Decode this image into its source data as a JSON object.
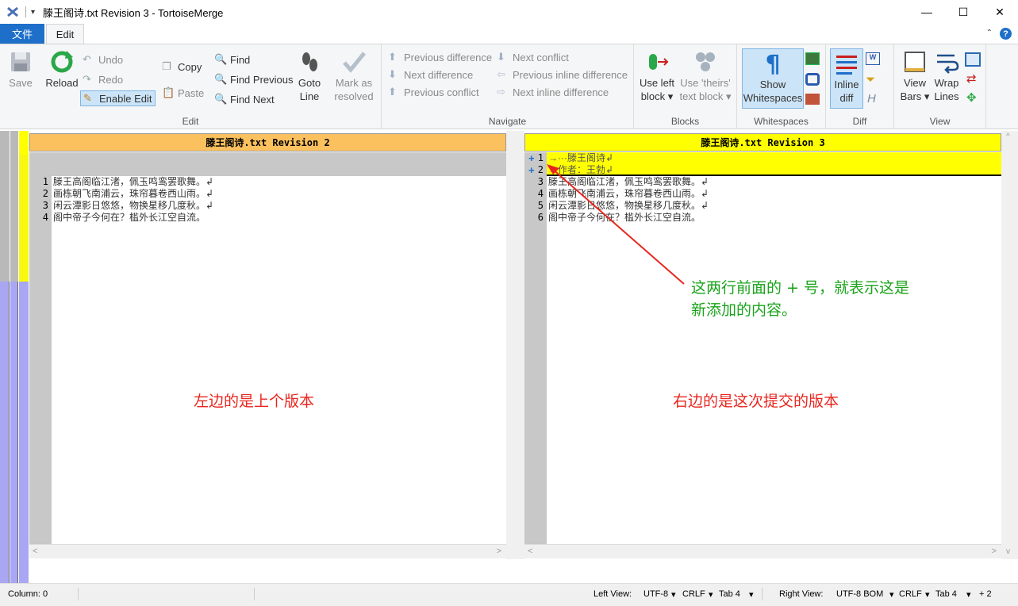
{
  "window": {
    "title": "滕王阁诗.txt Revision 3 - TortoiseMerge",
    "minimize": "—",
    "maximize": "☐",
    "close": "✕"
  },
  "tabs": {
    "file": "文件",
    "edit": "Edit",
    "help": "?"
  },
  "ribbon": {
    "save": "Save",
    "reload": "Reload",
    "undo": "Undo",
    "redo": "Redo",
    "enable_edit": "Enable Edit",
    "copy": "Copy",
    "paste": "Paste",
    "find": "Find",
    "find_previous": "Find Previous",
    "find_next": "Find Next",
    "goto_line_1": "Goto",
    "goto_line_2": "Line",
    "mark_resolved_1": "Mark as",
    "mark_resolved_2": "resolved",
    "edit_group": "Edit",
    "prev_diff": "Previous difference",
    "next_diff": "Next difference",
    "prev_conflict": "Previous conflict",
    "next_conflict": "Next conflict",
    "prev_inline": "Previous inline difference",
    "next_inline": "Next inline difference",
    "navigate_group": "Navigate",
    "use_left_1": "Use left",
    "use_left_2": "block ▾",
    "use_theirs_1": "Use 'theirs'",
    "use_theirs_2": "text block ▾",
    "blocks_group": "Blocks",
    "show_ws_1": "Show",
    "show_ws_2": "Whitespaces",
    "ws_group": "Whitespaces",
    "inline_1": "Inline",
    "inline_2": "diff",
    "diff_group": "Diff",
    "view_bars_1": "View",
    "view_bars_2": "Bars ▾",
    "wrap_1": "Wrap",
    "wrap_2": "Lines",
    "view_group": "View"
  },
  "left_pane": {
    "header": "滕王阁诗.txt Revision 2",
    "lines": [
      {
        "num": "1",
        "text": "滕王高阁临江渚，佩玉鸣鸾罢歌舞。↲"
      },
      {
        "num": "2",
        "text": "画栋朝飞南浦云，珠帘暮卷西山雨。↲"
      },
      {
        "num": "3",
        "text": "闲云潭影日悠悠，物换星移几度秋。↲"
      },
      {
        "num": "4",
        "text": "阁中帝子今何在？槛外长江空自流。"
      }
    ]
  },
  "right_pane": {
    "header": "滕王阁诗.txt Revision 3",
    "added_marker": "+",
    "lines": [
      {
        "num": "1",
        "text": "→···滕王阁诗↲"
      },
      {
        "num": "2",
        "text": "→作者：王勃↲"
      },
      {
        "num": "3",
        "text": "滕王高阁临江渚，佩玉鸣鸾罢歌舞。↲"
      },
      {
        "num": "4",
        "text": "画栋朝飞南浦云，珠帘暮卷西山雨。↲"
      },
      {
        "num": "5",
        "text": "闲云潭影日悠悠，物换星移几度秋。↲"
      },
      {
        "num": "6",
        "text": "阁中帝子今何在？槛外长江空自流。"
      }
    ]
  },
  "annotations": {
    "right_note_1": "这两行前面的 + 号，就表示这是",
    "right_note_2": "新添加的内容。",
    "left_label": "左边的是上个版本",
    "right_label": "右边的是这次提交的版本"
  },
  "status": {
    "column": "Column: 0",
    "left_view": "Left View:",
    "left_enc": "UTF-8",
    "left_eol": "CRLF",
    "left_tab": "Tab 4",
    "right_view": "Right View:",
    "right_enc": "UTF-8 BOM",
    "right_eol": "CRLF",
    "right_tab": "Tab 4",
    "right_changes": "+ 2"
  },
  "colors": {
    "header_left": "#fcc15f",
    "header_right": "#ffff00",
    "added_bg": "#ffff00",
    "annotation_green": "#1aa31a",
    "annotation_red": "#e8261f"
  }
}
